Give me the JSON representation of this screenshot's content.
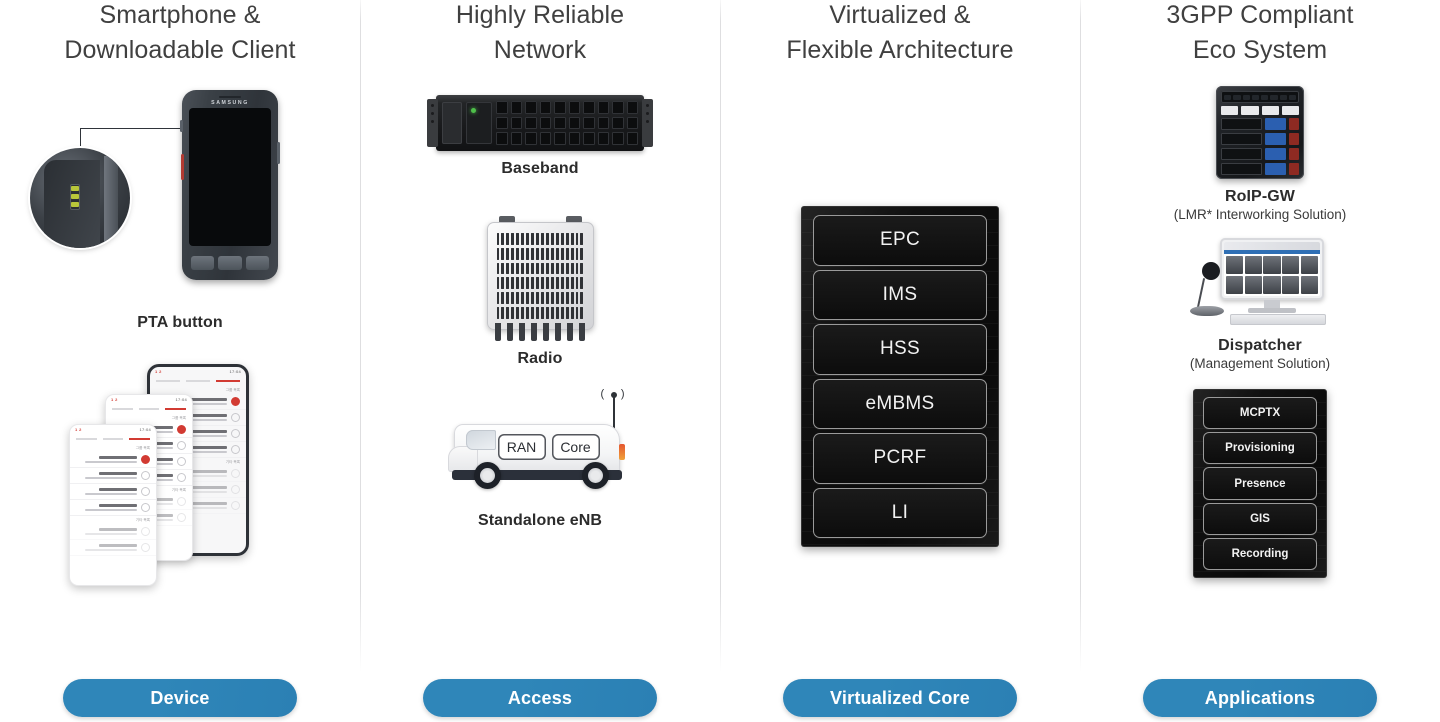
{
  "columns": [
    {
      "id": "device",
      "heading": "Smartphone &\nDownloadable Client",
      "pill": "Device",
      "items": [
        {
          "name": "phone-callout",
          "caption": "PTA button",
          "brand": "SAMSUNG"
        },
        {
          "name": "app-screenshots",
          "caption": ""
        }
      ]
    },
    {
      "id": "access",
      "heading": "Highly Reliable\nNetwork",
      "pill": "Access",
      "items": [
        {
          "name": "baseband",
          "caption": "Baseband"
        },
        {
          "name": "radio",
          "caption": "Radio"
        },
        {
          "name": "standalone-enb",
          "caption": "Standalone eNB",
          "tags": [
            "RAN",
            "Core"
          ]
        }
      ]
    },
    {
      "id": "virtualized-core",
      "heading": "Virtualized &\nFlexible Architecture",
      "pill": "Virtualized Core",
      "rack_units": [
        "EPC",
        "IMS",
        "HSS",
        "eMBMS",
        "PCRF",
        "LI"
      ]
    },
    {
      "id": "applications",
      "heading": "3GPP Compliant\nEco System",
      "pill": "Applications",
      "items": [
        {
          "name": "roip-gw",
          "caption": "RoIP-GW",
          "subcaption": "(LMR* Interworking Solution)"
        },
        {
          "name": "dispatcher",
          "caption": "Dispatcher",
          "subcaption": "(Management Solution)"
        }
      ],
      "rack_units": [
        "MCPTX",
        "Provisioning",
        "Presence",
        "GIS",
        "Recording"
      ]
    }
  ],
  "colors": {
    "pill_blue": "#2f86b9",
    "rack_dark": "#101010",
    "divider": "#dedee0",
    "heading_text": "#404040",
    "caption_text": "#2c2c2c"
  }
}
